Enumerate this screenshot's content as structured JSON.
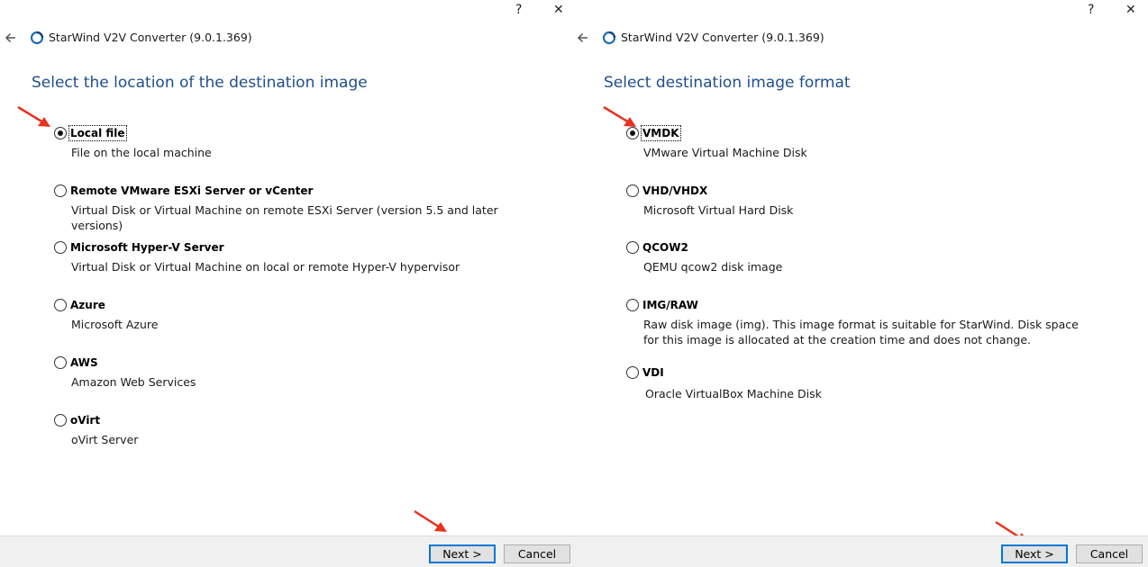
{
  "left": {
    "titlebar": {
      "help": "?",
      "close": "✕"
    },
    "app_title": "StarWind V2V Converter (9.0.1.369)",
    "page_title": "Select the location of the destination image",
    "options": [
      {
        "label": "Local file",
        "desc": "File on the local machine",
        "checked": true
      },
      {
        "label": "Remote VMware ESXi Server or vCenter",
        "desc": "Virtual Disk or Virtual Machine on remote ESXi Server (version 5.5 and later versions)",
        "checked": false
      },
      {
        "label": "Microsoft Hyper-V Server",
        "desc": "Virtual Disk or Virtual Machine on local or remote Hyper-V hypervisor",
        "checked": false
      },
      {
        "label": "Azure",
        "desc": "Microsoft Azure",
        "checked": false
      },
      {
        "label": "AWS",
        "desc": "Amazon Web Services",
        "checked": false
      },
      {
        "label": "oVirt",
        "desc": "oVirt Server",
        "checked": false
      }
    ],
    "buttons": {
      "next": "Next >",
      "cancel": "Cancel"
    }
  },
  "right": {
    "titlebar": {
      "help": "?",
      "close": "✕"
    },
    "app_title": "StarWind V2V Converter (9.0.1.369)",
    "page_title": "Select destination image format",
    "options": [
      {
        "label": "VMDK",
        "desc": "VMware Virtual Machine Disk",
        "checked": true
      },
      {
        "label": "VHD/VHDX",
        "desc": "Microsoft Virtual Hard Disk",
        "checked": false
      },
      {
        "label": "QCOW2",
        "desc": "QEMU qcow2 disk image",
        "checked": false
      },
      {
        "label": "IMG/RAW",
        "desc": "Raw disk image (img). This image format is suitable for StarWind. Disk space for this image is allocated at the creation time and does not change.",
        "checked": false
      },
      {
        "label": "VDI",
        "desc": "Oracle VirtualBox Machine Disk",
        "checked": false
      }
    ],
    "buttons": {
      "next": "Next >",
      "cancel": "Cancel"
    }
  },
  "colors": {
    "title_blue": "#1f4e8c",
    "annotation_red": "#e8321e",
    "focus_blue": "#0078d7",
    "footer_bg": "#f0f0f0"
  },
  "icons": {
    "back": "back-arrow-icon",
    "logo": "starwind-logo-icon",
    "annotation": "red-arrow-icon"
  }
}
